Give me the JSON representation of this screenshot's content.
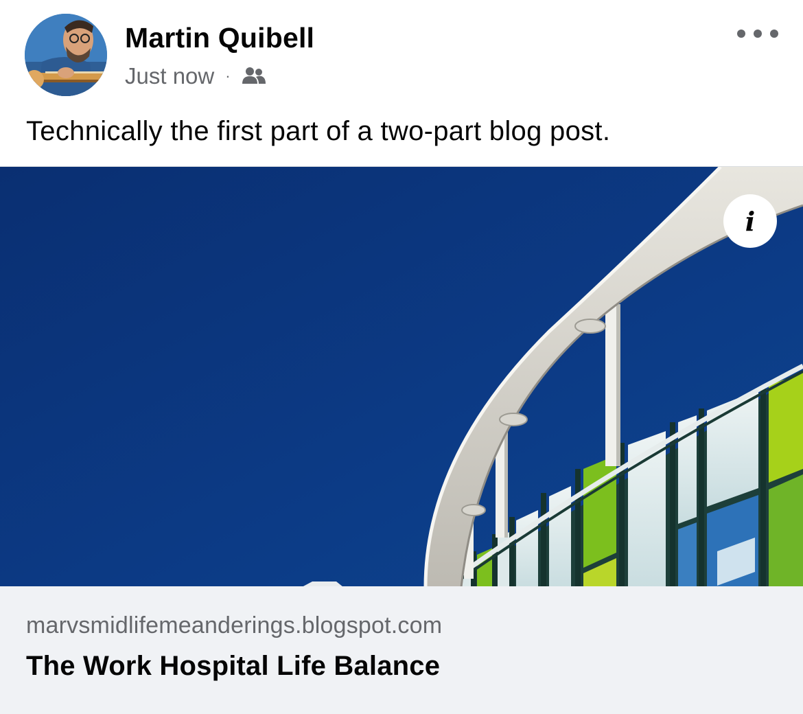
{
  "post": {
    "author": "Martin Quibell",
    "timestamp": "Just now",
    "separator": "·",
    "audience_icon": "friends-icon",
    "more_icon": "more-options-icon",
    "text": "Technically the first part of a two-part blog post."
  },
  "link_preview": {
    "image_description_icon": "info-icon",
    "info_glyph": "i",
    "domain": "marvsmidlifemeanderings.blogspot.com",
    "title": "The Work Hospital Life Balance"
  },
  "colors": {
    "sky": "#0c3a82",
    "secondary_text": "#65676b",
    "footer_bg": "#f0f2f5",
    "panel_green": "#7cbf1e",
    "panel_lime": "#a8d316"
  }
}
